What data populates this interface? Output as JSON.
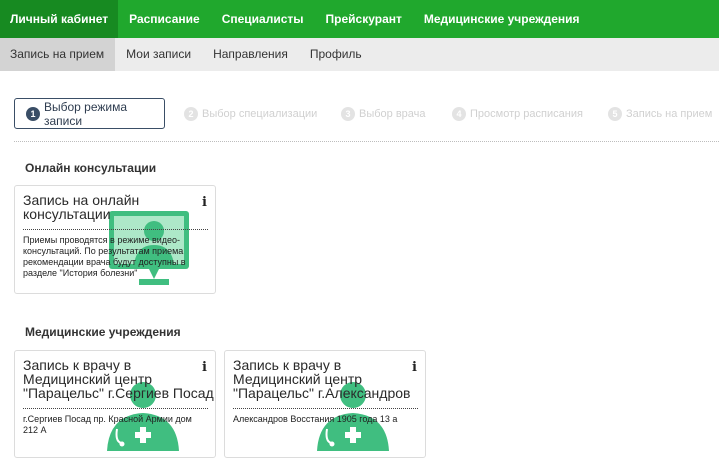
{
  "topnav": {
    "items": [
      "Личный кабинет",
      "Расписание",
      "Специалисты",
      "Прейскурант",
      "Медицинские учреждения"
    ]
  },
  "subnav": {
    "items": [
      "Запись на прием",
      "Мои записи",
      "Направления",
      "Профиль"
    ]
  },
  "steps": [
    {
      "num": "1",
      "label": "Выбор режима записи"
    },
    {
      "num": "2",
      "label": "Выбор специализации"
    },
    {
      "num": "3",
      "label": "Выбор врача"
    },
    {
      "num": "4",
      "label": "Просмотр расписания"
    },
    {
      "num": "5",
      "label": "Запись на прием"
    }
  ],
  "sections": {
    "online": "Онлайн консультации",
    "clinics": "Медицинские учреждения"
  },
  "cards": {
    "online": {
      "title_l1": "Запись на онлайн",
      "title_l2": "консультации",
      "info": "i",
      "desc_l1": "Приемы проводятся в режиме видео-",
      "desc_l2": "консультаций. По результатам приема",
      "desc_l3": "рекомендации врача будут доступны в",
      "desc_l4": "разделе \"История болезни\""
    },
    "sergiev": {
      "title_l1": "Запись к врачу в",
      "title_l2": "Медицинский центр",
      "title_l3": "\"Парацельс\" г.Сергиев Посад",
      "info": "i",
      "desc_l1": "г.Сергиев Посад пр. Красной Армии дом",
      "desc_l2": "212 А"
    },
    "alexandrov": {
      "title_l1": "Запись к врачу в",
      "title_l2": "Медицинский центр",
      "title_l3": "\"Парацельс\" г.Александров",
      "info": "i",
      "desc_l1": "Александров Восстания 1905 года 13 а"
    }
  },
  "colors": {
    "brand_green": "#20a82d",
    "brand_green_dark": "#178a21",
    "step_active": "#3a4e66",
    "art_green": "#1fb36a"
  }
}
